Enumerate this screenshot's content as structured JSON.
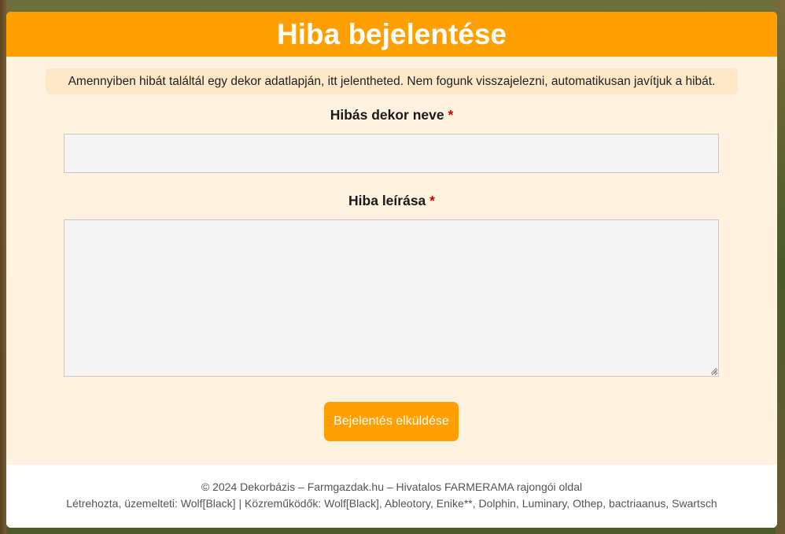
{
  "header": {
    "title": "Hiba bejelentése"
  },
  "notice": {
    "text": "Amennyiben hibát találtál egy dekor adatlapján, itt jelentheted. Nem fogunk visszajelezni, automatikusan javítjuk a hibát."
  },
  "form": {
    "decor_name": {
      "label": "Hibás dekor neve",
      "required_mark": "*",
      "value": ""
    },
    "description": {
      "label": "Hiba leírása",
      "required_mark": "*",
      "value": ""
    },
    "submit_label": "Bejelentés elküldése"
  },
  "footer": {
    "line1": "© 2024 Dekorbázis – Farmgazdak.hu – Hivatalos FARMERAMA rajongói oldal",
    "line2": "Létrehozta, üzemelteti: Wolf[Black] | Közreműködők: Wolf[Black], Ableotory, Enike**, Dolphin, Luminary, Othep, bactriaanus, Swartsch"
  },
  "colors": {
    "accent": "#ffa000",
    "panel": "#fff3e0",
    "notice_bg": "#ffe8c7",
    "required": "#cc0000"
  }
}
